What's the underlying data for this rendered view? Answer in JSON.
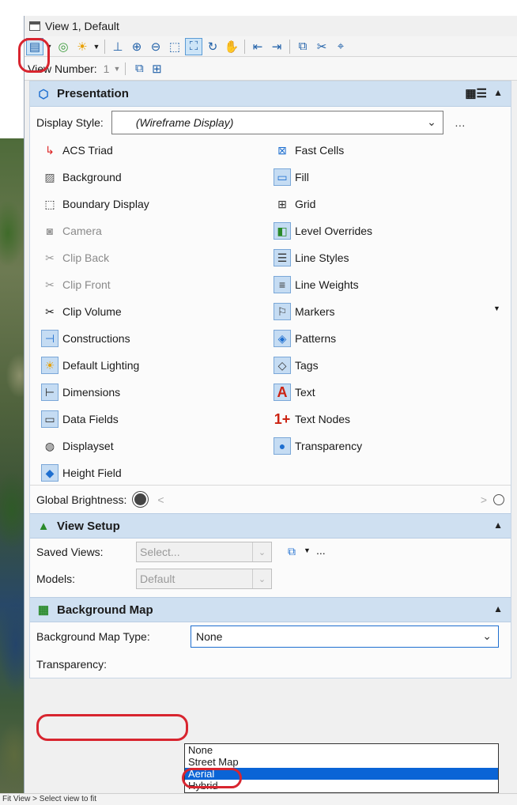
{
  "window": {
    "title": "View 1, Default"
  },
  "view_number": {
    "label": "View Number:",
    "value": "1"
  },
  "presentation": {
    "title": "Presentation",
    "display_style_label": "Display Style:",
    "display_style_value": "(Wireframe Display)",
    "left_items": [
      "ACS Triad",
      "Background",
      "Boundary Display",
      "Camera",
      "Clip Back",
      "Clip Front",
      "Clip Volume",
      "Constructions",
      "Default Lighting",
      "Dimensions",
      "Data Fields",
      "Displayset",
      "Height Field"
    ],
    "right_items": [
      "Fast Cells",
      "Fill",
      "Grid",
      "Level Overrides",
      "Line Styles",
      "Line Weights",
      "Markers",
      "Patterns",
      "Tags",
      "Text",
      "Text Nodes",
      "Transparency"
    ],
    "global_brightness_label": "Global Brightness:"
  },
  "view_setup": {
    "title": "View Setup",
    "saved_views_label": "Saved Views:",
    "saved_views_value": "Select...",
    "models_label": "Models:",
    "models_value": "Default",
    "more": "..."
  },
  "background_map": {
    "title": "Background Map",
    "type_label": "Background Map Type:",
    "type_value": "None",
    "transparency_label": "Transparency:",
    "options": [
      "None",
      "Street Map",
      "Aerial",
      "Hybrid"
    ],
    "highlighted": "Aerial"
  },
  "status_bar": {
    "text": "Fit View > Select view to fit"
  }
}
